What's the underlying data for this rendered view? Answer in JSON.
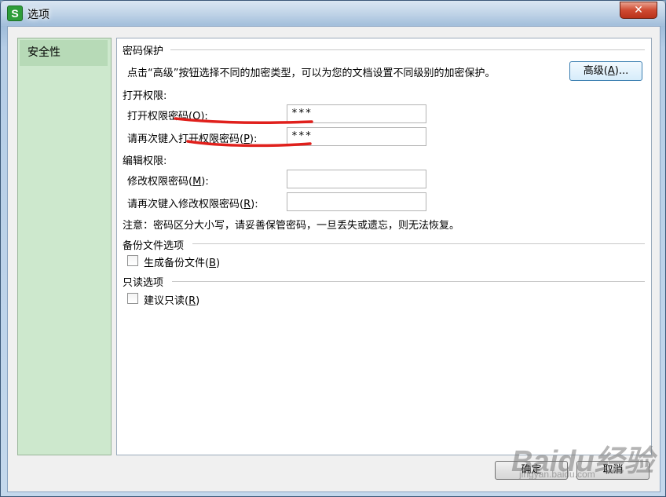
{
  "window": {
    "title": "选项",
    "app_icon_letter": "S",
    "close_symbol": "✕"
  },
  "sidebar": {
    "items": [
      {
        "label": "安全性",
        "selected": true
      }
    ]
  },
  "password_protection": {
    "section_title": "密码保护",
    "description": "点击“高级”按钮选择不同的加密类型，可以为您的文档设置不同级别的加密保护。",
    "advanced_button": "高级(A)..."
  },
  "open_permission": {
    "section_title": "打开权限:",
    "password_label": "打开权限密码(O):",
    "password_value": "***",
    "confirm_label": "请再次键入打开权限密码(P):",
    "confirm_value": "***"
  },
  "edit_permission": {
    "section_title": "编辑权限:",
    "password_label": "修改权限密码(M):",
    "password_value": "",
    "confirm_label": "请再次键入修改权限密码(R):",
    "confirm_value": ""
  },
  "note": "注意：密码区分大小写，请妥善保管密码，一旦丢失或遗忘，则无法恢复。",
  "backup": {
    "section_title": "备份文件选项",
    "checkbox_label": "生成备份文件(B)",
    "checked": false
  },
  "readonly": {
    "section_title": "只读选项",
    "checkbox_label": "建议只读(R)",
    "checked": false
  },
  "buttons": {
    "ok": "确定",
    "cancel": "取消"
  },
  "watermark": {
    "text": "Baidu经验",
    "url": "jingyan.baidu.com"
  },
  "colors": {
    "annotation_red": "#e0201c",
    "sidebar_bg": "#cde8cd",
    "button_border": "#3c7fb1"
  }
}
